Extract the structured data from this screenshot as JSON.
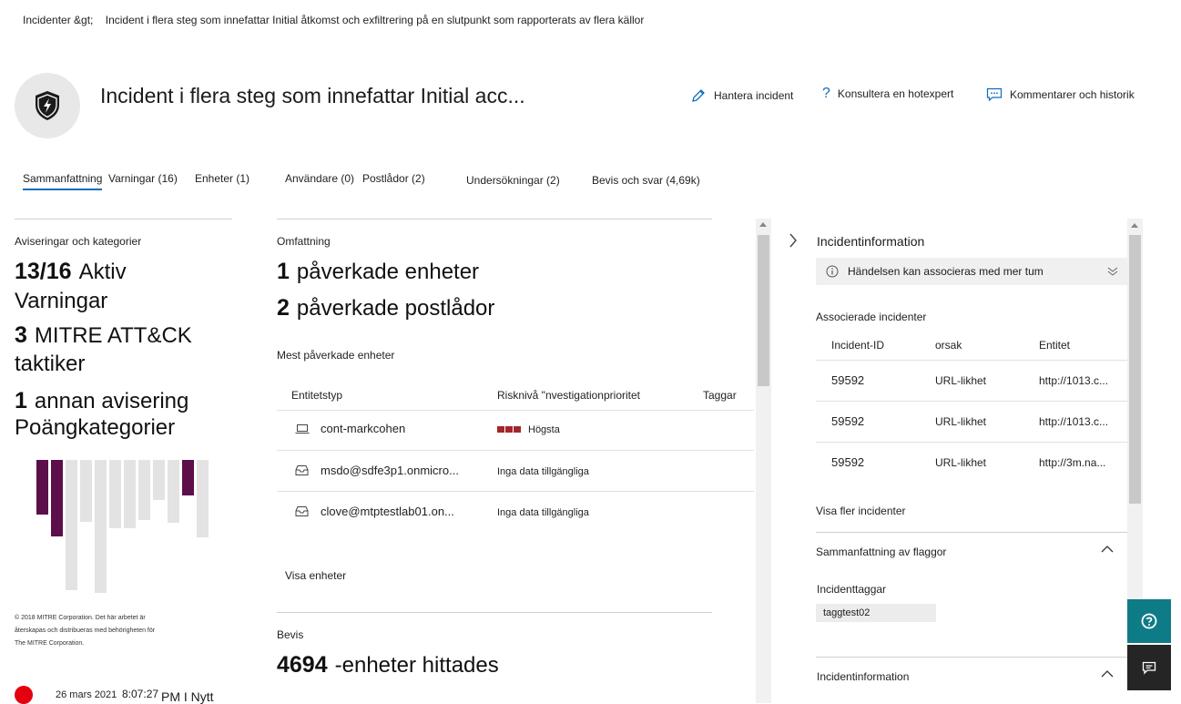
{
  "breadcrumb": {
    "root": "Incidenter &gt;",
    "current": "Incident i flera steg som innefattar Initial åtkomst och exfiltrering på en slutpunkt som rapporterats av flera källor"
  },
  "header": {
    "title": "Incident i flera steg som innefattar Initial acc...",
    "actions": {
      "manage": "Hantera incident",
      "consult": "Konsultera en hotexpert",
      "comments": "Kommentarer och historik"
    }
  },
  "tabs": [
    {
      "label": "Sammanfattning"
    },
    {
      "label": "Varningar (16)"
    },
    {
      "label": "Enheter (1)"
    },
    {
      "label": "Användare (0)"
    },
    {
      "label": "Postlådor (2)"
    },
    {
      "label": "Undersökningar (2)"
    },
    {
      "label": "Bevis och svar (4,69k)"
    }
  ],
  "left": {
    "heading": "Aviseringar och kategorier",
    "active_num": "13/16",
    "active_word": "Aktiv",
    "active_label": "Varningar",
    "mitre_num": "3",
    "mitre_word": "MITRE ATT&CK",
    "mitre_label": "taktiker",
    "other_num": "1",
    "other_word": "annan avisering",
    "other_label": "Poängkategorier",
    "copyright_1": "© 2018 MITRE Corporation. Det här arbetet är",
    "copyright_2": "återskapas och distribueras med behörigheten för",
    "copyright_3": "The MITRE Corporation.",
    "event_date": "26 mars 2021",
    "event_time": "8:07:27",
    "event_suffix": "PM I Nytt",
    "bar_fills": [
      {
        "fraction": 0.4,
        "color": "#5c0f4a"
      },
      {
        "fraction": 0.56,
        "color": "#5c0f4a"
      },
      {
        "fraction": 0.95,
        "color": "#e3e3e3"
      },
      {
        "fraction": 0.45,
        "color": "#e3e3e3"
      },
      {
        "fraction": 0.97,
        "color": "#e3e3e3"
      },
      {
        "fraction": 0.5,
        "color": "#e3e3e3"
      },
      {
        "fraction": 0.5,
        "color": "#e3e3e3"
      },
      {
        "fraction": 0.44,
        "color": "#e3e3e3"
      },
      {
        "fraction": 0.29,
        "color": "#e3e3e3"
      },
      {
        "fraction": 0.46,
        "color": "#e3e3e3"
      },
      {
        "fraction": 0.26,
        "color": "#5c0f4a"
      },
      {
        "fraction": 0.57,
        "color": "#e3e3e3"
      }
    ]
  },
  "middle": {
    "scope_heading": "Omfattning",
    "devices_num": "1",
    "devices_label": "påverkade enheter",
    "mailboxes_num": "2",
    "mailboxes_label": "påverkade postlådor",
    "most_affected": "Mest påverkade enheter",
    "columns": {
      "entity_type": "Entitetstyp",
      "risk": "Risknivå \"nvestigationprioritet",
      "tags": "Taggar"
    },
    "rows": [
      {
        "name": "cont-markcohen",
        "risk": "Högsta",
        "icon": "laptop-icon"
      },
      {
        "name": "msdo@sdfe3p1.onmicro...",
        "risk": "Inga data tillgängliga",
        "icon": "mailbox-icon"
      },
      {
        "name": "clove@mtptestlab01.on...",
        "risk": "Inga data tillgängliga",
        "icon": "mailbox-icon"
      }
    ],
    "view_devices": "Visa enheter",
    "evidence_heading": "Bevis",
    "evidence_num": "4694",
    "evidence_label": "-enheter hittades"
  },
  "right": {
    "title": "Incidentinformation",
    "notice": "Händelsen kan associeras med mer tum",
    "associated_heading": "Associerade incidenter",
    "columns": {
      "id": "Incident-ID",
      "reason": "orsak",
      "entity": "Entitet"
    },
    "rows": [
      {
        "id": "59592",
        "reason": "URL-likhet",
        "entity": "http://1013.c..."
      },
      {
        "id": "59592",
        "reason": "URL-likhet",
        "entity": "http://1013.c..."
      },
      {
        "id": "59592",
        "reason": "URL-likhet",
        "entity": "http://3m.na..."
      }
    ],
    "show_more": "Visa fler incidenter",
    "flags_summary": "Sammanfattning av flaggor",
    "incident_tags": "Incidenttaggar",
    "tag": "taggtest02",
    "info_heading": "Incidentinformation"
  },
  "colors": {
    "accent": "#0f6cbd",
    "risk_high": "#a4262c",
    "mitre_purple": "#5c0f4a",
    "side_teal": "#0e7c86",
    "side_dark": "#252525"
  }
}
